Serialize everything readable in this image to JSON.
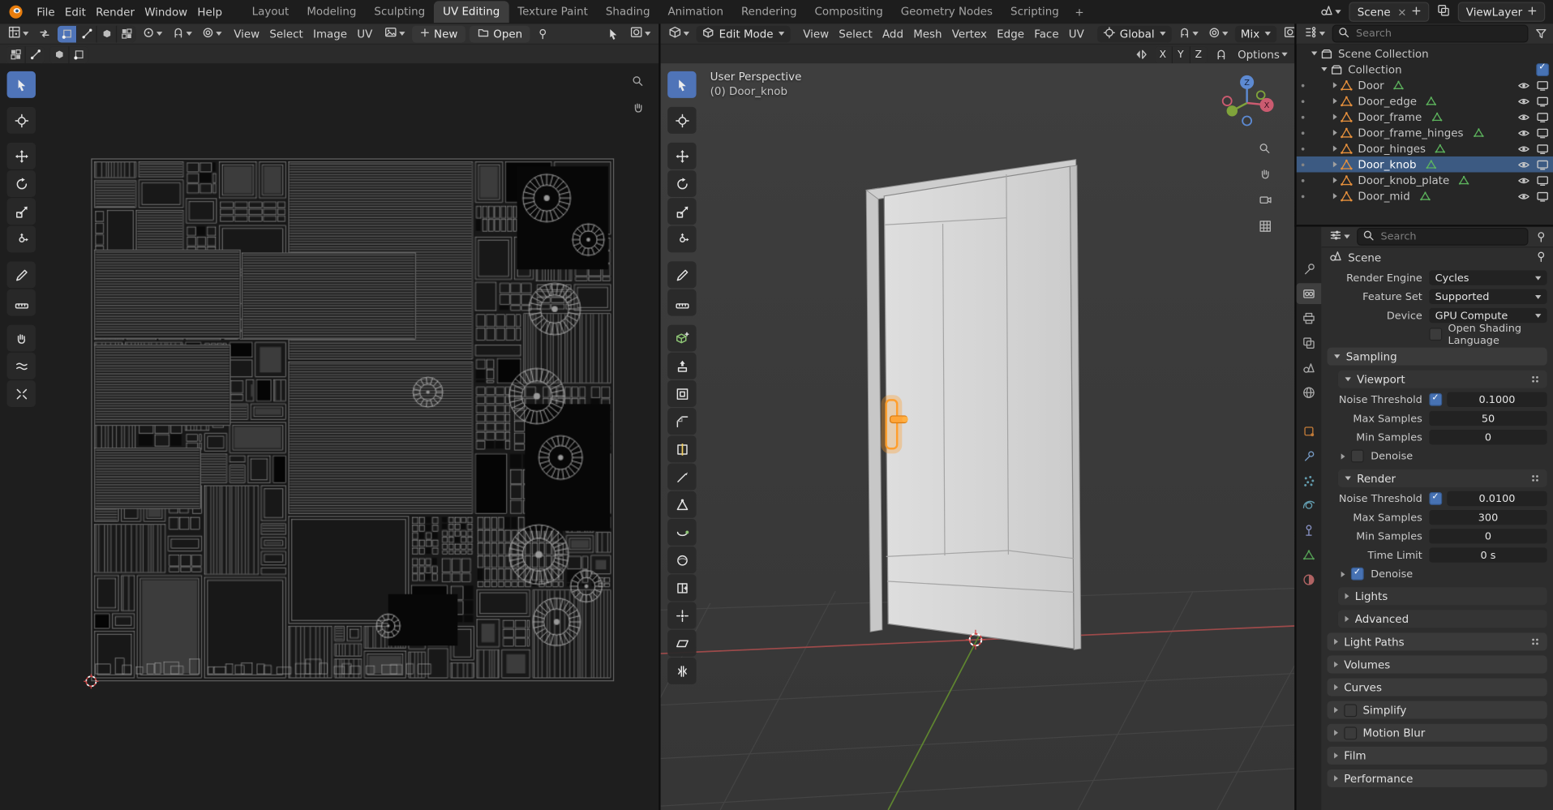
{
  "topbar": {
    "menus": [
      "File",
      "Edit",
      "Render",
      "Window",
      "Help"
    ],
    "workspaces": [
      "Layout",
      "Modeling",
      "Sculpting",
      "UV Editing",
      "Texture Paint",
      "Shading",
      "Animation",
      "Rendering",
      "Compositing",
      "Geometry Nodes",
      "Scripting"
    ],
    "active_workspace": "UV Editing",
    "add_workspace_label": "+",
    "scene_label": "Scene",
    "viewlayer_label": "ViewLayer"
  },
  "uv_editor": {
    "menus": [
      "View",
      "Select",
      "Image",
      "UV"
    ],
    "new_label": "New",
    "open_label": "Open",
    "tools": [
      "tweak",
      "cursor",
      "move",
      "rotate",
      "scale",
      "transform",
      "annotate",
      "measure",
      "grab",
      "relax",
      "pinch"
    ],
    "active_tool": "tweak"
  },
  "viewport": {
    "mode_label": "Edit Mode",
    "menus": [
      "View",
      "Select",
      "Add",
      "Mesh",
      "Vertex",
      "Edge",
      "Face",
      "UV"
    ],
    "orientation_label": "Global",
    "mix_label": "Mix",
    "options_label": "Options",
    "mirror_axes": [
      "X",
      "Y",
      "Z"
    ],
    "overlay": {
      "perspective": "User Perspective",
      "object": "(0) Door_knob"
    },
    "gizmo": {
      "x": "X",
      "z": "Z"
    },
    "tools": [
      "tweak",
      "cursor",
      "move",
      "rotate",
      "scale",
      "transform",
      "annotate",
      "measure",
      "add-cube",
      "extrude",
      "inset",
      "bevel",
      "loop-cut",
      "knife",
      "poly-build",
      "spin",
      "smooth",
      "edge-slide",
      "shrink",
      "shear",
      "rip"
    ],
    "active_tool": "tweak"
  },
  "outliner": {
    "search_placeholder": "Search",
    "scene_collection_label": "Scene Collection",
    "collection_label": "Collection",
    "objects": [
      {
        "label": "Door",
        "selected": false
      },
      {
        "label": "Door_edge",
        "selected": false
      },
      {
        "label": "Door_frame",
        "selected": false
      },
      {
        "label": "Door_frame_hinges",
        "selected": false
      },
      {
        "label": "Door_hinges",
        "selected": false
      },
      {
        "label": "Door_knob",
        "selected": true
      },
      {
        "label": "Door_knob_plate",
        "selected": false
      },
      {
        "label": "Door_mid",
        "selected": false
      }
    ]
  },
  "properties": {
    "search_placeholder": "Search",
    "context_label": "Scene",
    "tabs": [
      "tool",
      "render",
      "output",
      "view-layer",
      "scene",
      "world",
      "object",
      "modifiers",
      "particles",
      "physics",
      "constraints",
      "data",
      "material"
    ],
    "active_tab": "render",
    "panel_rows": [
      {
        "type": "field",
        "label": "Render Engine",
        "value": "Cycles"
      },
      {
        "type": "field",
        "label": "Feature Set",
        "value": "Supported"
      },
      {
        "type": "field",
        "label": "Device",
        "value": "GPU Compute"
      },
      {
        "type": "checkbox",
        "label": "Open Shading Language",
        "checked": false
      },
      {
        "type": "section",
        "label": "Sampling",
        "open": true,
        "level": 0
      },
      {
        "type": "section",
        "label": "Viewport",
        "open": true,
        "level": 1,
        "menu": true
      },
      {
        "type": "value",
        "label": "Noise Threshold",
        "checkbox": true,
        "value": "0.1000"
      },
      {
        "type": "value",
        "label": "Max Samples",
        "value": "50"
      },
      {
        "type": "value",
        "label": "Min Samples",
        "value": "0"
      },
      {
        "type": "disclosure",
        "label": "Denoise",
        "checked": false
      },
      {
        "type": "section",
        "label": "Render",
        "open": true,
        "level": 1,
        "menu": true
      },
      {
        "type": "value",
        "label": "Noise Threshold",
        "checkbox": true,
        "value": "0.0100"
      },
      {
        "type": "value",
        "label": "Max Samples",
        "value": "300"
      },
      {
        "type": "value",
        "label": "Min Samples",
        "value": "0"
      },
      {
        "type": "value",
        "label": "Time Limit",
        "value": "0 s"
      },
      {
        "type": "disclosure",
        "label": "Denoise",
        "checked": true
      },
      {
        "type": "section",
        "label": "Lights",
        "open": false,
        "level": 1
      },
      {
        "type": "section",
        "label": "Advanced",
        "open": false,
        "level": 1
      },
      {
        "type": "section",
        "label": "Light Paths",
        "open": false,
        "level": 0,
        "menu": true
      },
      {
        "type": "section",
        "label": "Volumes",
        "open": false,
        "level": 0
      },
      {
        "type": "section",
        "label": "Curves",
        "open": false,
        "level": 0
      },
      {
        "type": "section",
        "label": "Simplify",
        "open": false,
        "level": 0,
        "checkbox": false
      },
      {
        "type": "section",
        "label": "Motion Blur",
        "open": false,
        "level": 0,
        "checkbox": false
      },
      {
        "type": "section",
        "label": "Film",
        "open": false,
        "level": 0
      },
      {
        "type": "section",
        "label": "Performance",
        "open": false,
        "level": 0
      }
    ]
  },
  "colors": {
    "accent": "#4772b3",
    "selection": "#ff9e2c",
    "axis_x": "#9d4a4a",
    "axis_y": "#5f8530"
  }
}
